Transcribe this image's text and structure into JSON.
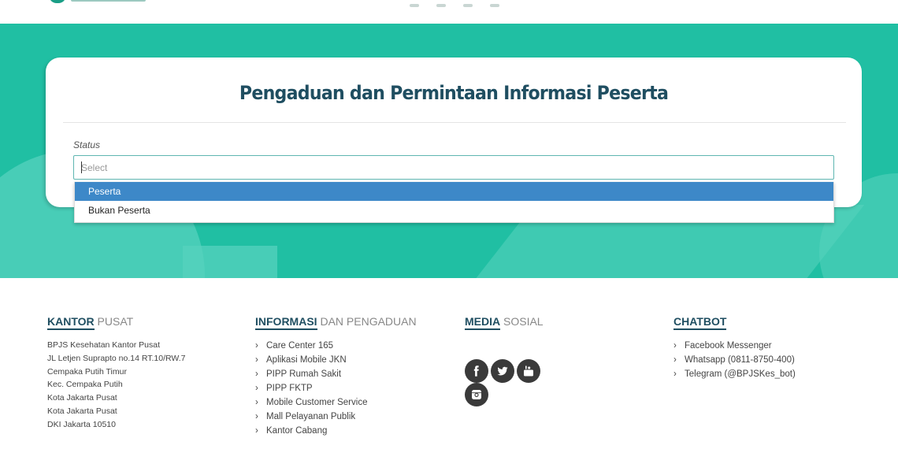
{
  "form": {
    "title": "Pengaduan dan Permintaan Informasi Peserta",
    "status_label": "Status",
    "status_placeholder": "Select",
    "options": [
      "Peserta",
      "Bukan Peserta"
    ],
    "highlighted_option": "Peserta"
  },
  "footer": {
    "kantor": {
      "title_bold": "KANTOR",
      "title_rest": "PUSAT",
      "address": [
        "BPJS Kesehatan Kantor Pusat",
        "JL Letjen Suprapto no.14 RT.10/RW.7",
        "Cempaka Putih Timur",
        "Kec. Cempaka Putih",
        "Kota Jakarta Pusat",
        "Kota Jakarta Pusat",
        "DKI Jakarta 10510"
      ]
    },
    "informasi": {
      "title_bold": "INFORMASI",
      "title_rest": "DAN PENGADUAN",
      "links": [
        "Care Center 165",
        "Aplikasi Mobile JKN",
        "PIPP Rumah Sakit",
        "PIPP FKTP",
        "Mobile Customer Service",
        "Mall Pelayanan Publik",
        "Kantor Cabang"
      ]
    },
    "media": {
      "title_bold": "MEDIA",
      "title_rest": "SOSIAL",
      "icons": [
        "facebook-icon",
        "twitter-icon",
        "youtube-icon",
        "instagram-icon"
      ]
    },
    "chatbot": {
      "title_bold": "CHATBOT",
      "title_rest": "",
      "links": [
        "Facebook Messenger",
        "Whatsapp (0811-8750-400)",
        "Telegram (@BPJSKes_bot)"
      ]
    }
  },
  "colors": {
    "accent": "#20bfa3",
    "title": "#1f4e61",
    "highlight": "#3d88c8"
  }
}
